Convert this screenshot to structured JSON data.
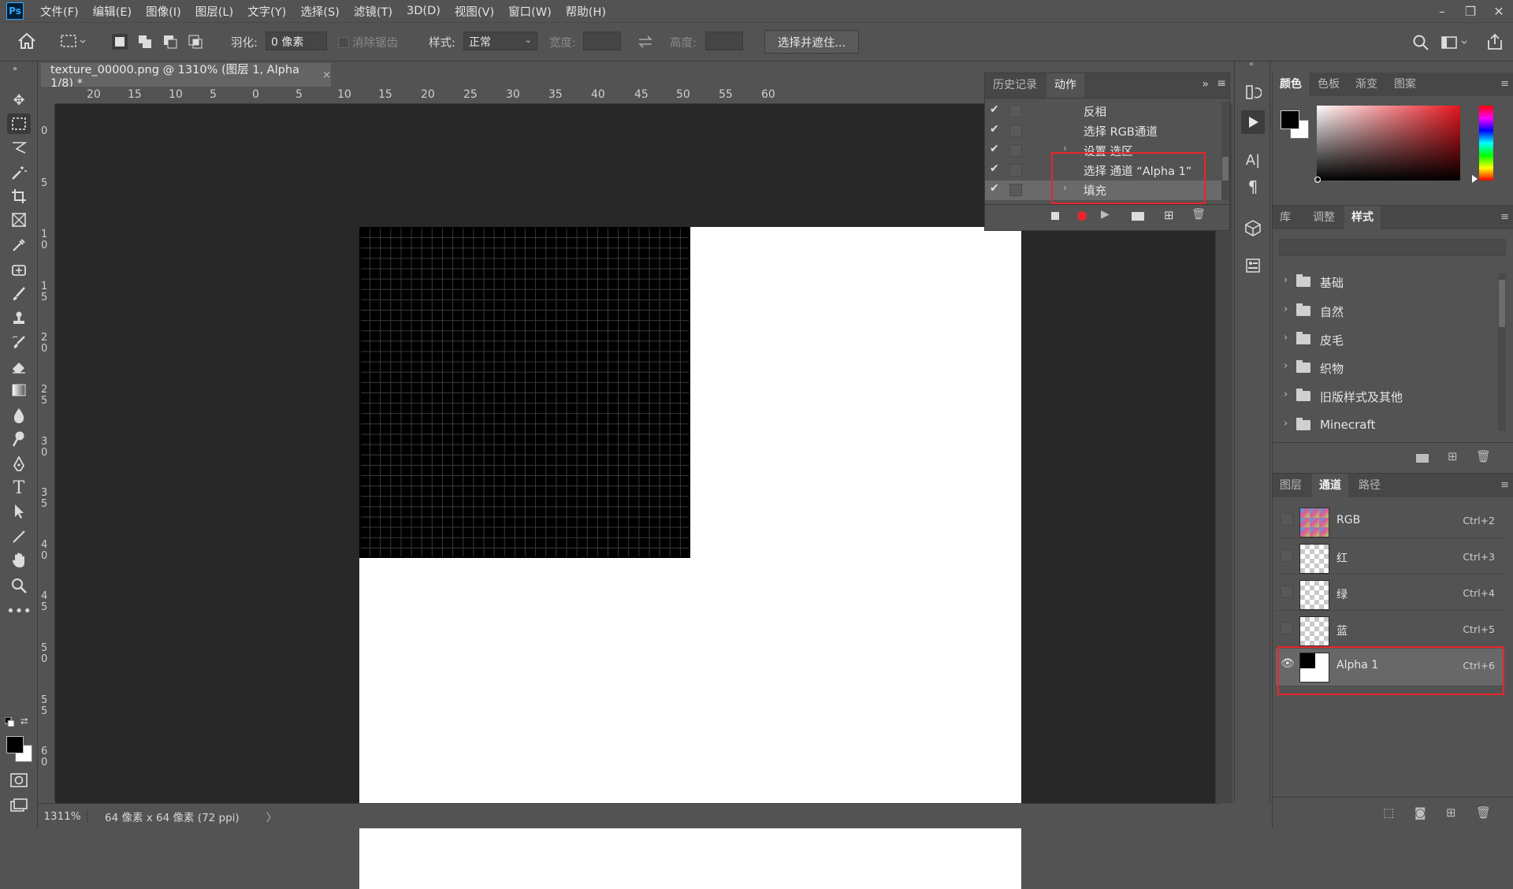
{
  "menubar": {
    "logo": "Ps",
    "items": [
      "文件(F)",
      "编辑(E)",
      "图像(I)",
      "图层(L)",
      "文字(Y)",
      "选择(S)",
      "滤镜(T)",
      "3D(D)",
      "视图(V)",
      "窗口(W)",
      "帮助(H)"
    ]
  },
  "window_controls": {
    "minimize": "–",
    "restore": "❐",
    "close": "✕"
  },
  "options": {
    "feather_label": "羽化:",
    "feather_value": "0 像素",
    "antialias_label": "消除锯齿",
    "style_label": "样式:",
    "style_value": "正常",
    "width_label": "宽度:",
    "height_label": "高度:",
    "select_mask_button": "选择并遮住..."
  },
  "document": {
    "tab_title": "texture_00000.png @ 1310% (图层 1, Alpha 1/8) *",
    "close": "×"
  },
  "ruler_top": [
    "5",
    "20",
    "15",
    "10",
    "5",
    "0",
    "5",
    "10",
    "15",
    "20",
    "25",
    "30",
    "35",
    "40",
    "45",
    "50",
    "55",
    "60"
  ],
  "ruler_left": [
    "0",
    "5",
    "10",
    "15",
    "20",
    "25",
    "30",
    "35",
    "40",
    "45",
    "50",
    "55",
    "60"
  ],
  "status": {
    "zoom": "1311%",
    "doc_size": "64 像素 x 64 像素 (72 ppi)",
    "arrow": "〉"
  },
  "actions_panel": {
    "tabs": [
      "历史记录",
      "动作"
    ],
    "active_tab": "动作",
    "expand": "»",
    "rows": [
      {
        "text": "反相",
        "checked": true,
        "arrow": ""
      },
      {
        "text": "选择 RGB通道",
        "checked": true,
        "arrow": ""
      },
      {
        "text": "设置 选区",
        "checked": true,
        "arrow": "›"
      },
      {
        "text": "选择 通道 “Alpha 1”",
        "checked": true,
        "arrow": ""
      },
      {
        "text": "填充",
        "checked": true,
        "arrow": "›"
      }
    ]
  },
  "color_panel": {
    "tabs": [
      "颜色",
      "色板",
      "渐变",
      "图案"
    ],
    "active_tab": "颜色",
    "foreground": "#000000",
    "background": "#ffffff"
  },
  "library_panel": {
    "tabs": [
      "库",
      "调整",
      "样式"
    ],
    "active_tab": "样式",
    "folders": [
      "基础",
      "自然",
      "皮毛",
      "织物",
      "旧版样式及其他",
      "Minecraft"
    ]
  },
  "channels_panel": {
    "tabs": [
      "图层",
      "通道",
      "路径"
    ],
    "active_tab": "通道",
    "channels": [
      {
        "name": "RGB",
        "shortcut": "Ctrl+2",
        "visible": false
      },
      {
        "name": "红",
        "shortcut": "Ctrl+3",
        "visible": false
      },
      {
        "name": "绿",
        "shortcut": "Ctrl+4",
        "visible": false
      },
      {
        "name": "蓝",
        "shortcut": "Ctrl+5",
        "visible": false
      },
      {
        "name": "Alpha 1",
        "shortcut": "Ctrl+6",
        "visible": true
      }
    ]
  },
  "colors": {
    "highlight": "#e8262c",
    "panel": "#535353",
    "workspace": "#282828"
  }
}
